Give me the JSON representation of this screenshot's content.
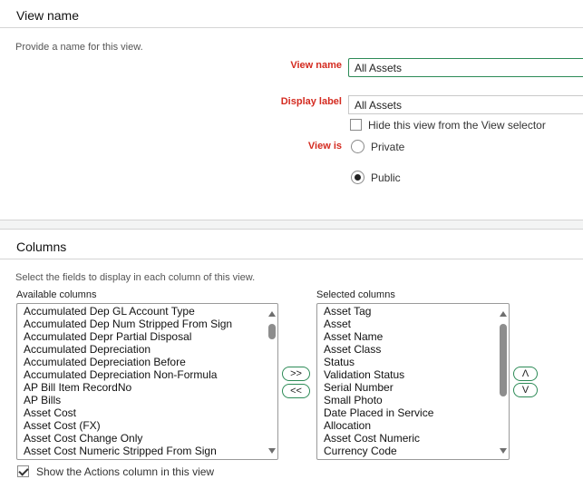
{
  "view_name_section": {
    "title": "View name",
    "help": "Provide a name for this view.",
    "view_name_label": "View name",
    "view_name_value": "All Assets",
    "display_label_label": "Display label",
    "display_label_value": "All Assets",
    "hide_checkbox_label": "Hide this view from the View selector",
    "hide_checked": false,
    "view_is_label": "View is",
    "options": [
      {
        "label": "Private",
        "selected": false
      },
      {
        "label": "Public",
        "selected": true
      }
    ]
  },
  "columns_section": {
    "title": "Columns",
    "help": "Select the fields to display in each column of this view.",
    "available_label": "Available columns",
    "available": [
      "Accumulated Dep GL Account Type",
      "Accumulated Dep Num Stripped From Sign",
      "Accumulated Depr Partial Disposal",
      "Accumulated Depreciation",
      "Accumulated Depreciation Before",
      "Accumulated Depreciation Non-Formula",
      "AP Bill Item RecordNo",
      "AP Bills",
      "Asset Cost",
      "Asset Cost (FX)",
      "Asset Cost Change Only",
      "Asset Cost Numeric Stripped From Sign"
    ],
    "add_label": ">>",
    "remove_label": "<<",
    "selected_label": "Selected columns",
    "selected": [
      "Asset Tag",
      "Asset",
      "Asset Name",
      "Asset Class",
      "Status",
      "Validation Status",
      "Serial Number",
      "Small Photo",
      "Date Placed in Service",
      "Allocation",
      "Asset Cost Numeric",
      "Currency Code"
    ],
    "move_up_label": "Λ",
    "move_down_label": "V",
    "show_actions_label": "Show the Actions column in this view",
    "show_actions_checked": true
  },
  "colors": {
    "accent": "#2d8b57",
    "required": "#d42b20",
    "band": "#f3f4f4"
  }
}
